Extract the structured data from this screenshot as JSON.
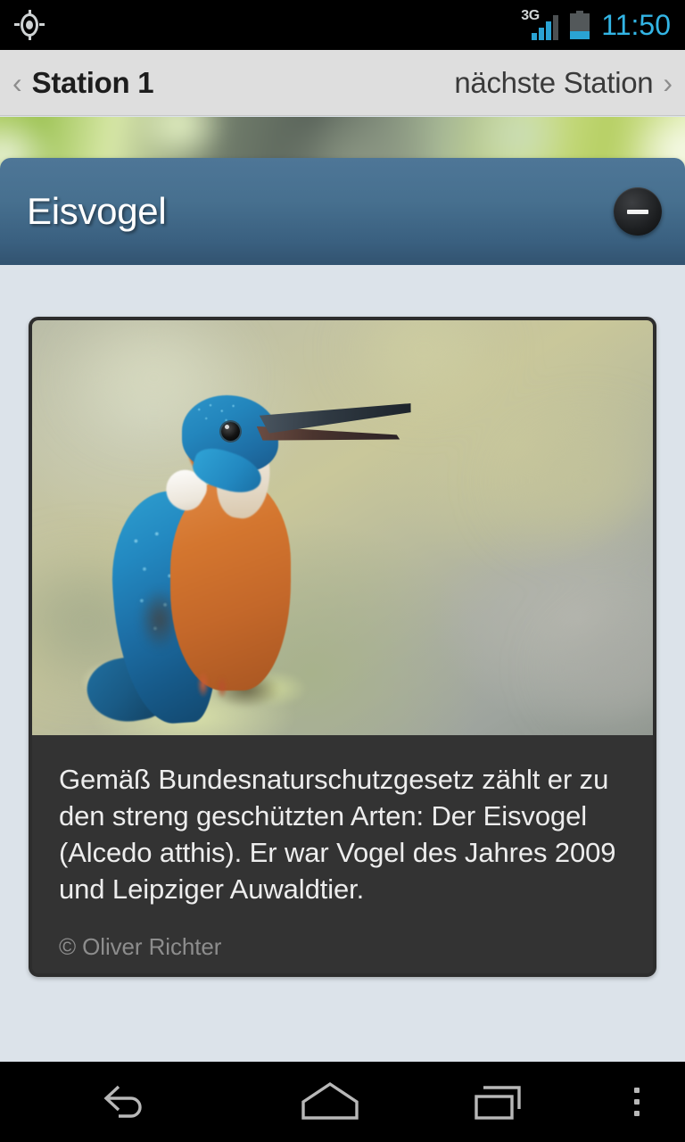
{
  "status_bar": {
    "gps_icon": "gps-crosshair-icon",
    "network_type": "3G",
    "signal_icon": "signal-bars-icon",
    "signal_bars_active": 3,
    "signal_bars_total": 4,
    "battery_icon": "battery-icon",
    "battery_level_percent": 32,
    "time": "11:50",
    "accent_color": "#33b5e5"
  },
  "nav_header": {
    "back_chevron": "‹",
    "prev_label": "Station 1",
    "next_label": "nächste Station",
    "forward_chevron": "›",
    "background_color": "#dedede"
  },
  "title_bar": {
    "title": "Eisvogel",
    "collapse_icon": "minus-icon",
    "background_color": "#47708f"
  },
  "card": {
    "photo_alt": "kingfisher-photo",
    "body_text": "Gemäß Bundesnaturschutzgesetz zählt er zu den streng geschützten Arten: Der Eisvogel (Alcedo atthis). Er war Vogel des Jahres 2009 und Leipziger Auwaldtier.",
    "credit": "© Oliver Richter",
    "background_color": "#333333"
  },
  "bottom_nav": {
    "back_icon": "back-arrow-icon",
    "home_icon": "home-icon",
    "recents_icon": "recent-apps-icon",
    "overflow_icon": "overflow-menu-icon"
  },
  "page": {
    "background_color": "#dce3ea"
  }
}
